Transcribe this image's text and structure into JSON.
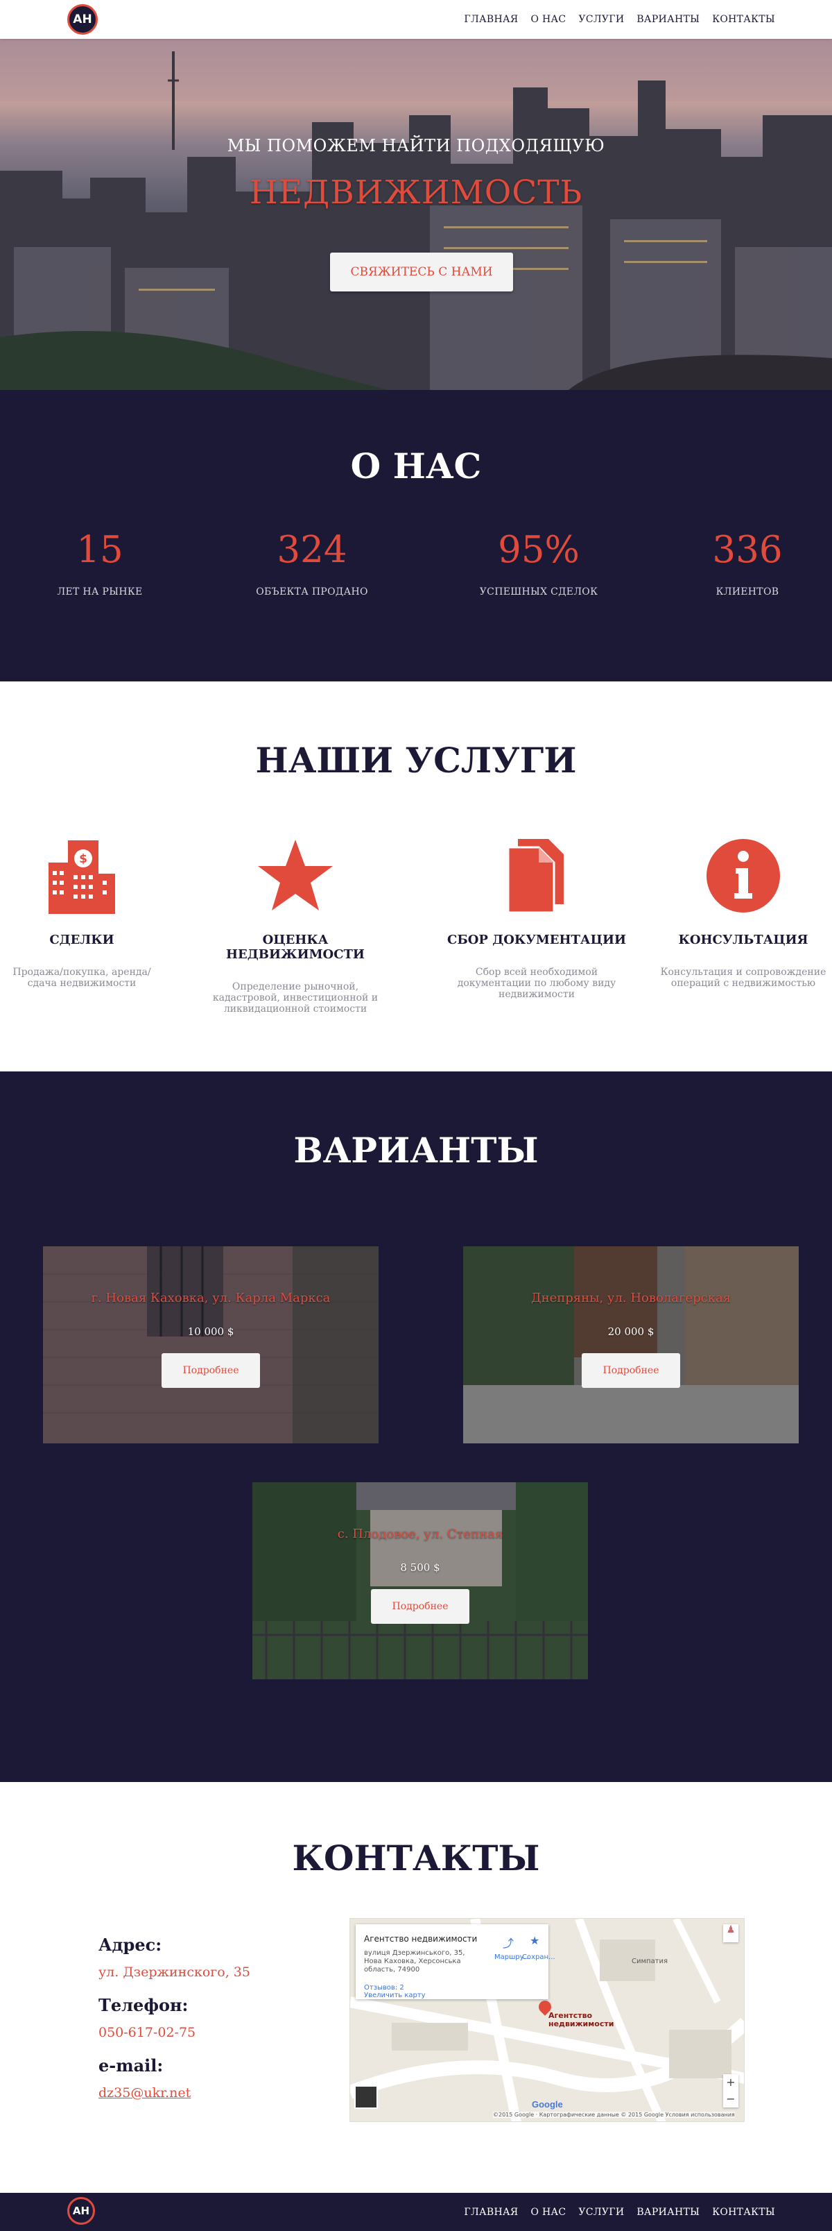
{
  "logo": {
    "text": "АН"
  },
  "nav": [
    "ГЛАВНАЯ",
    "О НАС",
    "УСЛУГИ",
    "ВАРИАНТЫ",
    "КОНТАКТЫ"
  ],
  "hero": {
    "title": "МЫ ПОМОЖЕМ НАЙТИ ПОДХОДЯЩУЮ",
    "subtitle": "НЕДВИЖИМОСТЬ",
    "button": "СВЯЖИТЕСЬ С НАМИ"
  },
  "about": {
    "title": "О НАС",
    "stats": [
      {
        "value": "15",
        "label": "ЛЕТ НА РЫНКЕ"
      },
      {
        "value": "324",
        "label": "ОБЪЕКТА ПРОДАНО"
      },
      {
        "value": "95%",
        "label": "УСПЕШНЫХ СДЕЛОК"
      },
      {
        "value": "336",
        "label": "КЛИЕНТОВ"
      }
    ]
  },
  "services": {
    "title": "НАШИ УСЛУГИ",
    "items": [
      {
        "icon": "buildings-icon",
        "title": "СДЕЛКИ",
        "desc": "Продажа/покупка, аренда/сдача недвижимости"
      },
      {
        "icon": "star-icon",
        "title": "ОЦЕНКА НЕДВИЖИМОСТИ",
        "desc": "Определение рыночной, кадастровой, инвестиционной и ликвидационной стоимости"
      },
      {
        "icon": "documents-icon",
        "title": "СБОР ДОКУМЕНТАЦИИ",
        "desc": "Сбор всей необходимой документации по любому виду недвижимости"
      },
      {
        "icon": "info-icon",
        "title": "КОНСУЛЬТАЦИЯ",
        "desc": "Консультация и сопровождение операций с недвижимостью"
      }
    ]
  },
  "variants": {
    "title": "ВАРИАНТЫ",
    "items": [
      {
        "title": "г. Новая Каховка, ул. Карла Маркса",
        "price": "10 000 $",
        "button": "Подробнее"
      },
      {
        "title": "Днепряны, ул. Новолагерская",
        "price": "20 000 $",
        "button": "Подробнее"
      },
      {
        "title": "с. Плодовое, ул. Степная",
        "price": "8 500 $",
        "button": "Подробнее"
      }
    ]
  },
  "contacts": {
    "title": "КОНТАКТЫ",
    "address_label": "Адрес:",
    "address": "ул. Дзержинского, 35",
    "phone_label": "Телефон:",
    "phone": "050-617-02-75",
    "email_label": "e-mail:",
    "email": "dz35@ukr.net"
  },
  "map": {
    "place_title": "Агентство недвижимости",
    "place_address": "вулиця Дзержинського, 35, Нова Каховка, Херсонська область, 74900",
    "reviews": "Отзывов: 2",
    "enlarge": "Увеличить карту",
    "route": "Маршру...",
    "save": "Сохран...",
    "pin_label": "Агентство недвижимости",
    "poi": "Симпатия",
    "google": "Google",
    "copyright": "©2015 Google · Картографические данные © 2015 Google    Условия использования",
    "zoom_in": "+",
    "zoom_out": "−"
  }
}
